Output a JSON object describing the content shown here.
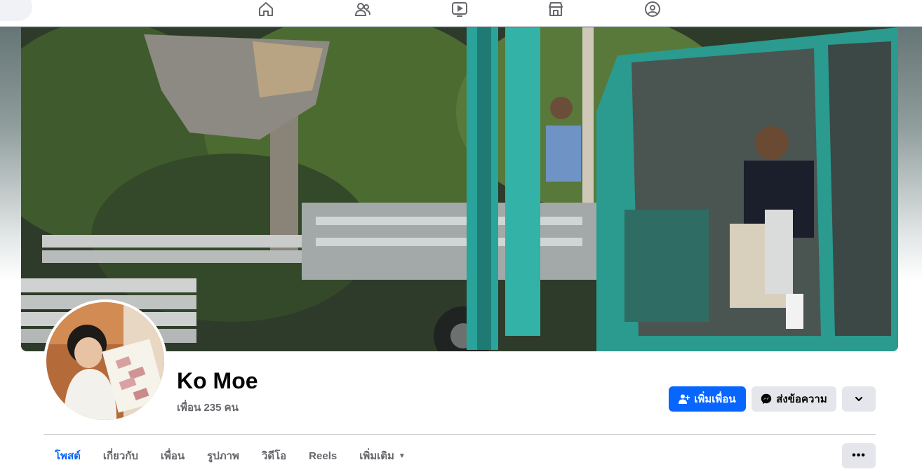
{
  "profile": {
    "name": "Ko Moe",
    "friends_text": "เพื่อน 235 คน"
  },
  "actions": {
    "add_friend": "เพิ่มเพื่อน",
    "message": "ส่งข้อความ"
  },
  "tabs": [
    {
      "label": "โพสต์",
      "active": true
    },
    {
      "label": "เกี่ยวกับ"
    },
    {
      "label": "เพื่อน"
    },
    {
      "label": "รูปภาพ"
    },
    {
      "label": "วิดีโอ"
    },
    {
      "label": "Reels"
    },
    {
      "label": "เพิ่มเติม"
    }
  ],
  "topnav": {
    "icons": [
      "home-icon",
      "friends-icon",
      "video-icon",
      "marketplace-icon",
      "groups-icon"
    ]
  },
  "colors": {
    "accent": "#0866ff",
    "secondary_button": "#e4e6eb",
    "text_primary": "#050505",
    "text_secondary": "#65676b"
  }
}
